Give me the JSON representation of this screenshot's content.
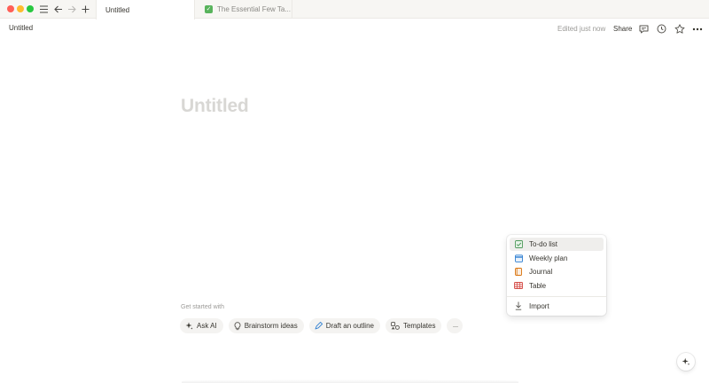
{
  "window": {
    "tabs": [
      {
        "label": "Untitled",
        "active": true
      },
      {
        "label": "The Essential Few Ta...",
        "active": false,
        "icon": "check-emoji-icon"
      }
    ]
  },
  "header": {
    "breadcrumb": "Untitled",
    "edited_status": "Edited just now",
    "share_label": "Share",
    "icons": [
      "comment-icon",
      "history-clock-icon",
      "star-icon",
      "more-horizontal-icon"
    ]
  },
  "page": {
    "title_placeholder": "Untitled"
  },
  "get_started": {
    "label": "Get started with",
    "chips": [
      {
        "label": "Ask AI",
        "icon": "sparkle-icon"
      },
      {
        "label": "Brainstorm ideas",
        "icon": "lightbulb-icon"
      },
      {
        "label": "Draft an outline",
        "icon": "pen-icon"
      },
      {
        "label": "Templates",
        "icon": "templates-icon"
      }
    ],
    "more_label": "···"
  },
  "menu": {
    "items": [
      {
        "label": "To-do list",
        "icon": "todo-checkbox-icon",
        "highlighted": true
      },
      {
        "label": "Weekly plan",
        "icon": "calendar-icon"
      },
      {
        "label": "Journal",
        "icon": "journal-icon"
      },
      {
        "label": "Table",
        "icon": "table-icon"
      }
    ],
    "import_label": "Import"
  },
  "colors": {
    "accent_blue": "#2f7fd1",
    "todo_green": "#4f9a5b",
    "journal_orange": "#d9730d",
    "table_red": "#d44c47"
  }
}
